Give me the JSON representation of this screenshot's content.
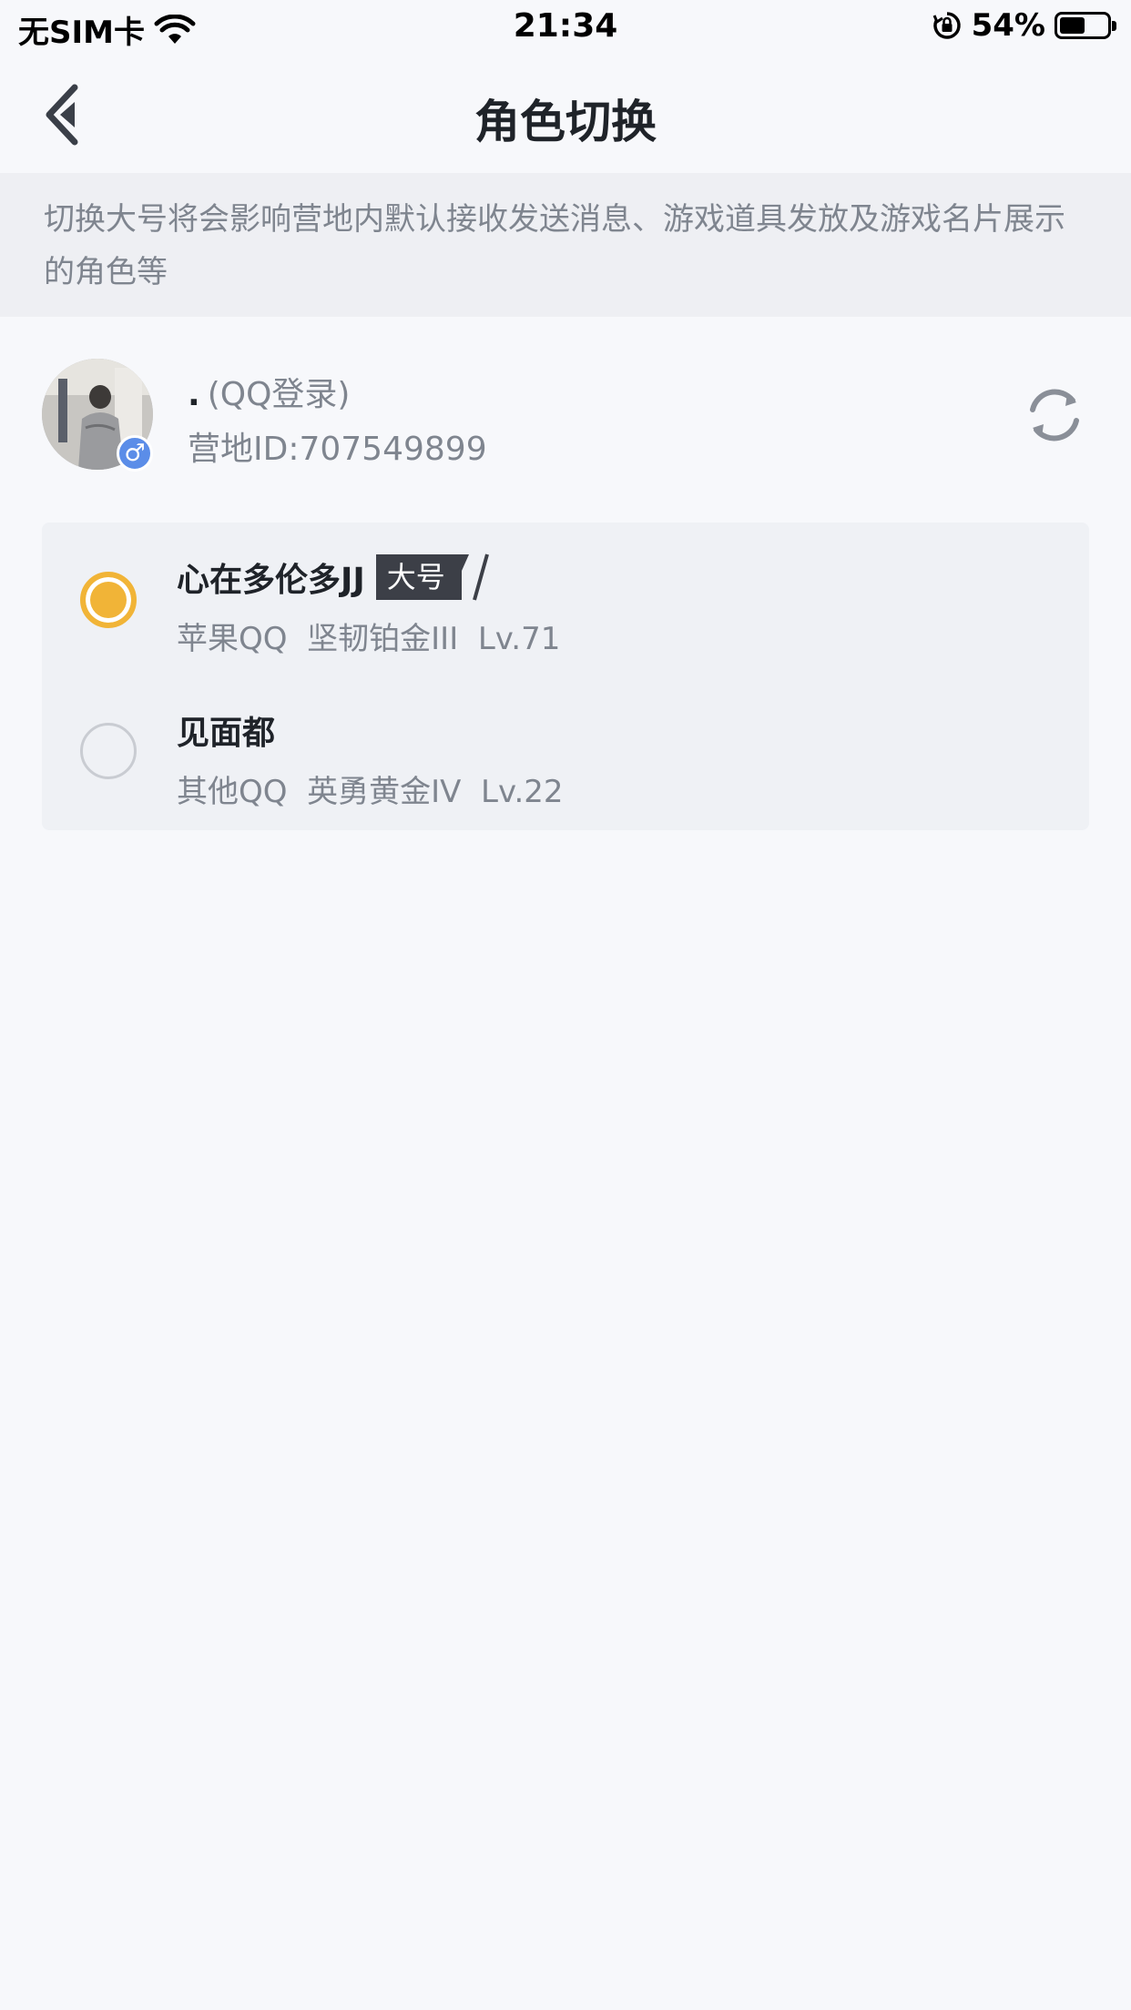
{
  "status_bar": {
    "carrier": "无SIM卡",
    "time": "21:34",
    "battery": "54%",
    "battery_level": 0.54
  },
  "nav": {
    "title": "角色切换"
  },
  "notice": {
    "text": "切换大号将会影响营地内默认接收发送消息、游戏道具发放及游戏名片展示的角色等"
  },
  "account": {
    "name_dot": ".",
    "login_type": "(QQ登录)",
    "camp_id": "营地ID:707549899",
    "gender_symbol": "♂"
  },
  "roles": [
    {
      "name": "心在多伦多JJ",
      "tag": "大号",
      "info": "苹果QQ  坚韧铂金III  Lv.71",
      "selected": true
    },
    {
      "name": "见面都",
      "tag": "",
      "info": "其他QQ  英勇黄金IV  Lv.22",
      "selected": false
    }
  ],
  "icons": {
    "back": "chevron-left-icon",
    "refresh": "refresh-icon",
    "wifi": "wifi-icon",
    "rotation_lock": "rotation-lock-icon",
    "battery": "battery-icon"
  },
  "colors": {
    "accent": "#f1b437",
    "background": "#f7f8fb",
    "card": "#eff1f5",
    "notice_bg": "#eeeff3",
    "tag_bg": "#3c3f47",
    "gender_badge": "#5b8de8"
  }
}
